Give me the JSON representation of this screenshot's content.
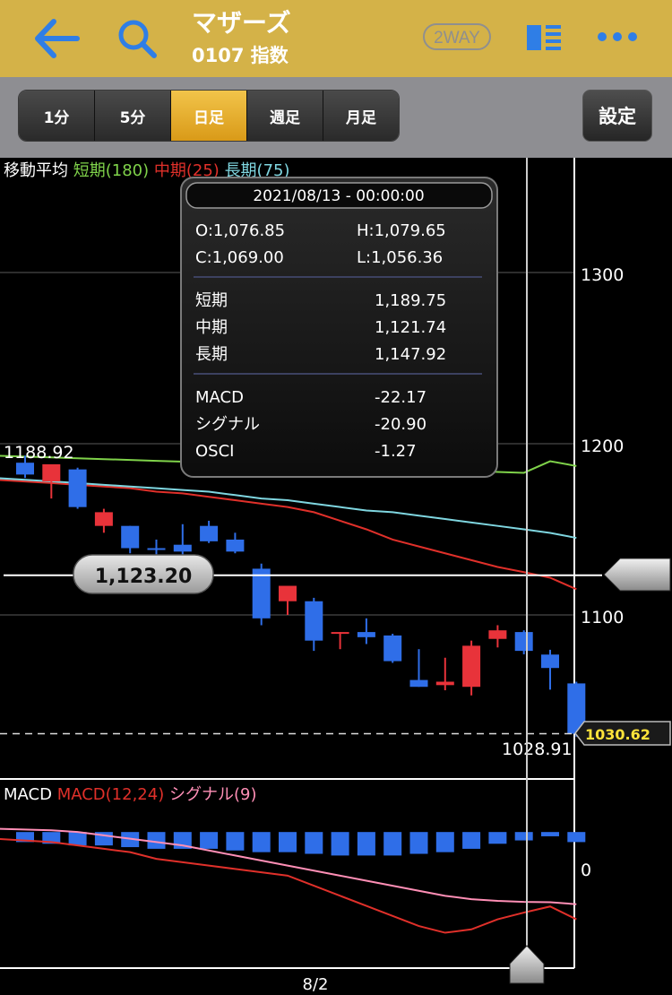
{
  "header": {
    "title": "マザーズ",
    "subtitle": "0107 指数",
    "twoway_label": "2WAY",
    "icons": [
      "back-arrow-icon",
      "search-icon",
      "layout-toggle-icon",
      "more-icon"
    ],
    "color": "#d4b248"
  },
  "timeframe": {
    "tabs": [
      "1分",
      "5分",
      "日足",
      "週足",
      "月足"
    ],
    "active_index": 2,
    "settings_label": "設定"
  },
  "legend": {
    "prefix": "移動平均",
    "short": "短期(180)",
    "mid": "中期(25)",
    "long": "長期(75)",
    "short_color": "#7fd24a",
    "mid_color": "#e0302a",
    "long_color": "#7fd6e0"
  },
  "tooltip": {
    "date": "2021/08/13 - 00:00:00",
    "open": "O:1,076.85",
    "high": "H:1,079.65",
    "close": "C:1,069.00",
    "low": "L:1,056.36",
    "ma_rows": [
      {
        "label": "短期",
        "value": "1,189.75"
      },
      {
        "label": "中期",
        "value": "1,121.74"
      },
      {
        "label": "長期",
        "value": "1,147.92"
      }
    ],
    "macd_rows": [
      {
        "label": "MACD",
        "value": "-22.17"
      },
      {
        "label": "シグナル",
        "value": "-20.90"
      },
      {
        "label": "OSCI",
        "value": "-1.27"
      }
    ]
  },
  "price": {
    "y_ticks": [
      "1300",
      "1200",
      "1100"
    ],
    "max_label": "1188.92",
    "min_label": "1028.91",
    "crosshair_label": "1,123.20",
    "last_price": "1030.62",
    "up_color": "#e8333a",
    "down_color": "#2f6ee8"
  },
  "macd": {
    "label": "MACD",
    "macd_name": "MACD(12,24)",
    "signal_name": "シグナル(9)",
    "zero_label": "0",
    "macd_color": "#e0302a",
    "signal_color": "#ff8fb6",
    "osci_color": "#2f6ee8"
  },
  "x_axis": {
    "date_label": "8/2"
  },
  "chart_data": {
    "type": "candlestick",
    "ylim": [
      1000,
      1340
    ],
    "candles": [
      {
        "o": 1188.9,
        "h": 1193,
        "l": 1180,
        "c": 1182
      },
      {
        "o": 1178,
        "h": 1184,
        "l": 1168,
        "c": 1188
      },
      {
        "o": 1185,
        "h": 1186,
        "l": 1162,
        "c": 1163
      },
      {
        "o": 1152,
        "h": 1162,
        "l": 1148,
        "c": 1160
      },
      {
        "o": 1152,
        "h": 1152,
        "l": 1136,
        "c": 1139
      },
      {
        "o": 1139,
        "h": 1144,
        "l": 1126,
        "c": 1138
      },
      {
        "o": 1141,
        "h": 1153,
        "l": 1133,
        "c": 1137
      },
      {
        "o": 1152,
        "h": 1155,
        "l": 1142,
        "c": 1143
      },
      {
        "o": 1144,
        "h": 1148,
        "l": 1136,
        "c": 1137
      },
      {
        "o": 1127,
        "h": 1130,
        "l": 1094,
        "c": 1098
      },
      {
        "o": 1108,
        "h": 1116,
        "l": 1100,
        "c": 1117
      },
      {
        "o": 1108,
        "h": 1110,
        "l": 1079,
        "c": 1085
      },
      {
        "o": 1089,
        "h": 1090,
        "l": 1080,
        "c": 1090
      },
      {
        "o": 1090,
        "h": 1098,
        "l": 1083,
        "c": 1087
      },
      {
        "o": 1088,
        "h": 1089,
        "l": 1072,
        "c": 1073
      },
      {
        "o": 1062,
        "h": 1080,
        "l": 1058,
        "c": 1058
      },
      {
        "o": 1059,
        "h": 1075,
        "l": 1056,
        "c": 1061
      },
      {
        "o": 1058,
        "h": 1085,
        "l": 1053,
        "c": 1082
      },
      {
        "o": 1086,
        "h": 1094,
        "l": 1081,
        "c": 1091
      },
      {
        "o": 1090,
        "h": 1091,
        "l": 1077,
        "c": 1079
      },
      {
        "o": 1076.85,
        "h": 1079.65,
        "l": 1056.36,
        "c": 1069.0
      },
      {
        "o": 1060,
        "h": 1061,
        "l": 1028.91,
        "c": 1030.62
      }
    ],
    "ma_short": [
      1193,
      1192,
      1191.5,
      1191,
      1190.5,
      1190,
      1189.5,
      1189,
      1188.5,
      1188,
      1187.5,
      1187,
      1186.5,
      1186,
      1185.5,
      1185,
      1184.5,
      1184,
      1183.5,
      1183,
      1189.75,
      1187
    ],
    "ma_mid": [
      1179,
      1177,
      1176,
      1175,
      1174,
      1172,
      1171,
      1169,
      1167,
      1165,
      1163,
      1160,
      1155,
      1150,
      1144,
      1140,
      1136,
      1132,
      1128,
      1125,
      1121.74,
      1115
    ],
    "ma_long": [
      1180,
      1178,
      1177,
      1176,
      1175,
      1174,
      1173,
      1172,
      1170,
      1168,
      1167,
      1165,
      1163,
      1161,
      1160,
      1158,
      1156,
      1154,
      1152,
      1150,
      1147.92,
      1145
    ],
    "macd_ylim": [
      -40,
      15
    ],
    "macd_series": [
      -2,
      -3,
      -4,
      -5,
      -6,
      -8,
      -9,
      -10,
      -11,
      -12,
      -13,
      -16,
      -19,
      -22,
      -25,
      -28,
      -30,
      -29,
      -26,
      -24,
      -22.17,
      -26
    ],
    "signal_series": [
      1,
      0.5,
      0,
      -1,
      -2,
      -3,
      -4,
      -5.5,
      -7,
      -8.5,
      -10,
      -11.5,
      -13,
      -14.5,
      -16,
      -17.5,
      -19,
      -20,
      -20.5,
      -20.8,
      -20.9,
      -21.5
    ],
    "osci_series": [
      -3,
      -3.5,
      -4,
      -4,
      -4.5,
      -5,
      -5,
      -5,
      -5.5,
      -6,
      -6,
      -6.5,
      -7,
      -7,
      -7,
      -6.5,
      -6,
      -5,
      -3.5,
      -2.5,
      -1.27,
      -3
    ],
    "crosshair_index": 20,
    "crosshair_value": 1123.2
  }
}
